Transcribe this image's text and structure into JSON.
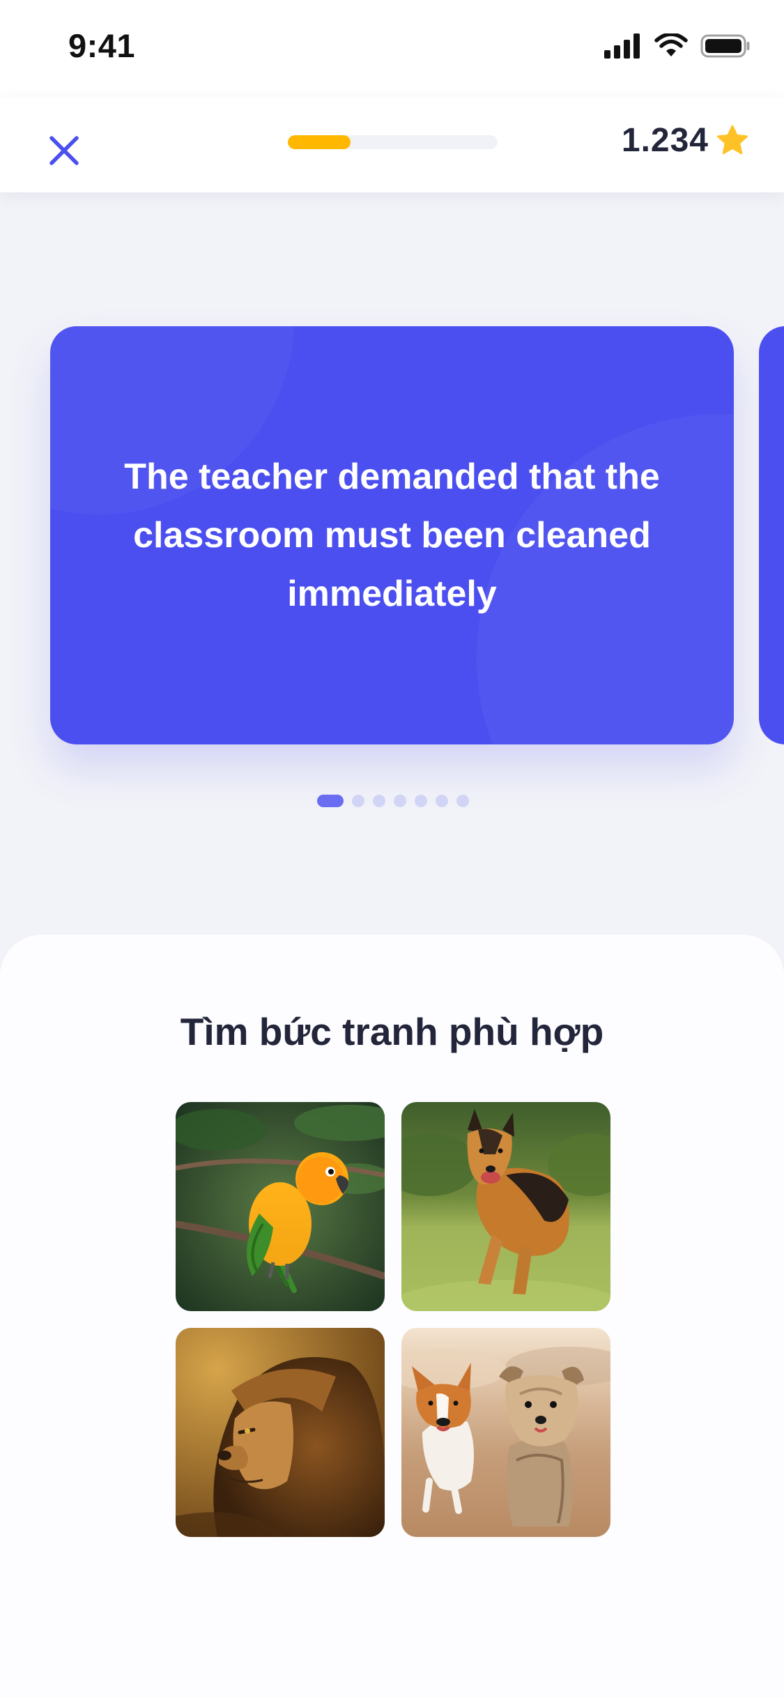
{
  "status_bar": {
    "time": "9:41",
    "icons": [
      "signal-icon",
      "wifi-icon",
      "battery-icon"
    ]
  },
  "header": {
    "close_icon": "close-icon",
    "progress_fraction": 0.3,
    "score": "1.234",
    "score_icon": "star-icon"
  },
  "card": {
    "text": "The teacher demanded that the classroom must been cleaned immediately",
    "total_cards": 7,
    "active_index": 0
  },
  "panel": {
    "title": "Tìm bức tranh phù hợp",
    "options": [
      "parrot",
      "german-shepherd",
      "lion",
      "corgi-and-yorkie"
    ]
  },
  "colors": {
    "accent": "#4b4ff0",
    "progress": "#ffb700",
    "star": "#ffc226",
    "background": "#f2f3f8"
  }
}
